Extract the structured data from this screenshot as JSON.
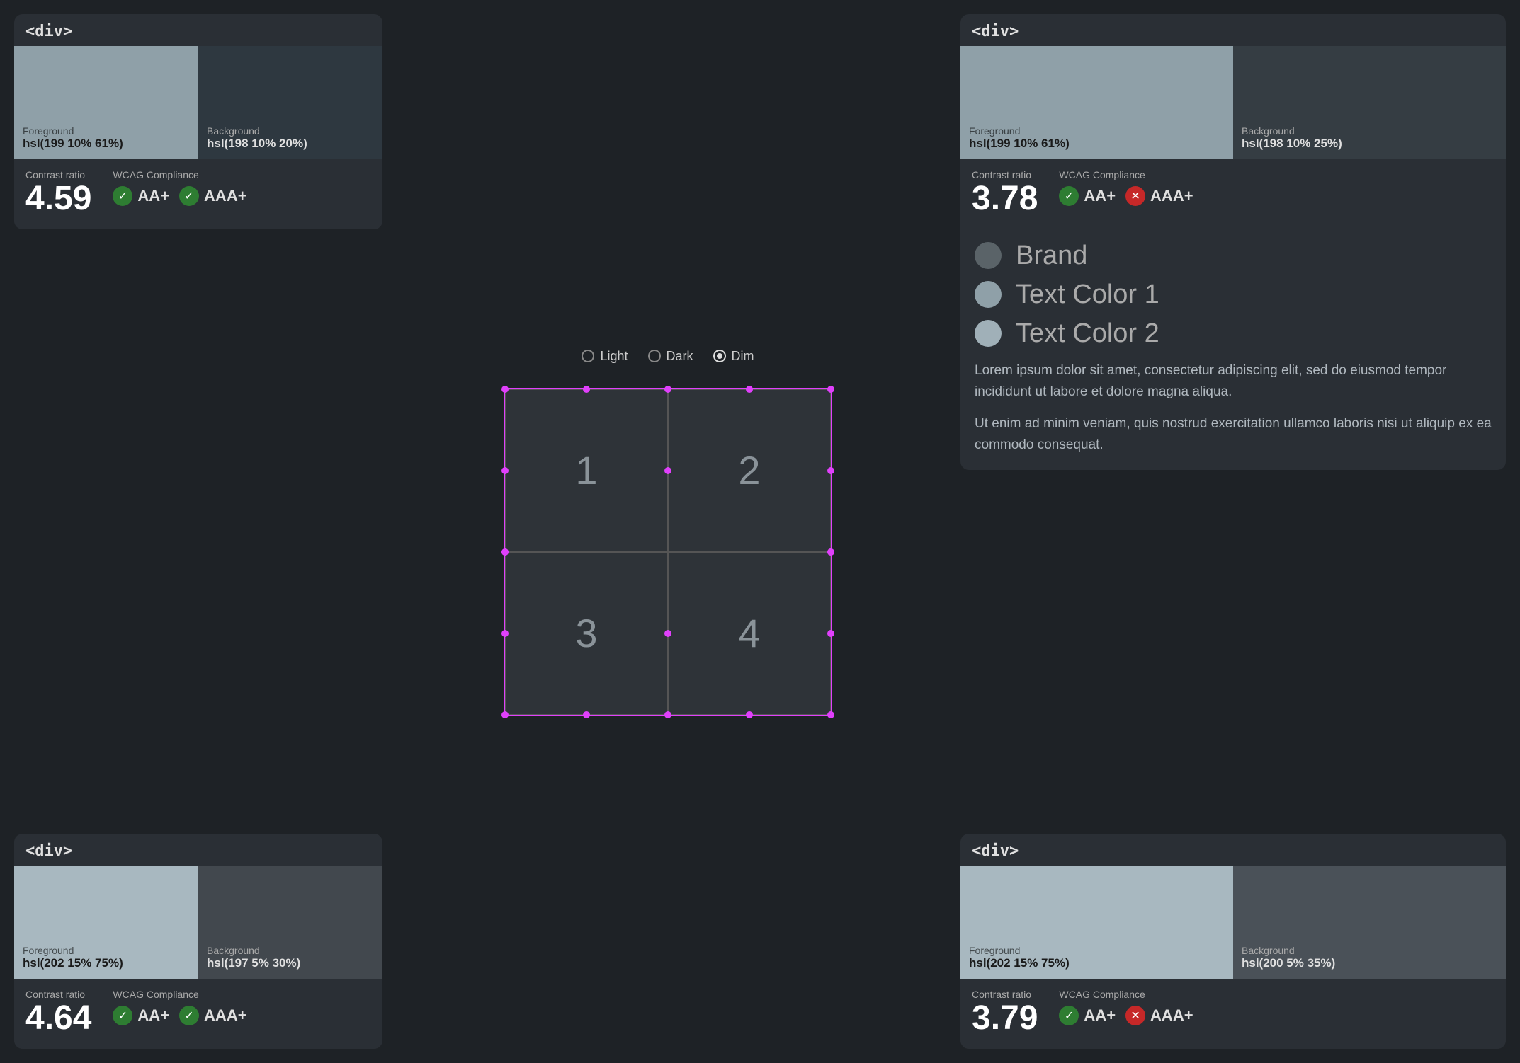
{
  "panels": {
    "topLeft": {
      "tag": "<div>",
      "foreground": {
        "label": "Foreground",
        "value": "hsl(199 10% 61%)"
      },
      "background": {
        "label": "Background",
        "value": "hsl(198 10% 20%)"
      },
      "contrastLabel": "Contrast ratio",
      "contrastValue": "4.59",
      "wcagLabel": "WCAG Compliance",
      "badges": [
        {
          "icon": "check",
          "type": "green",
          "label": "AA+"
        },
        {
          "icon": "check",
          "type": "green",
          "label": "AAA+"
        }
      ],
      "swatchFgBg": "#8fa0a8",
      "swatchBg": "#2e3840"
    },
    "topRight": {
      "tag": "<div>",
      "foreground": {
        "label": "Foreground",
        "value": "hsl(199 10% 61%)"
      },
      "background": {
        "label": "Background",
        "value": "hsl(198 10% 25%)"
      },
      "contrastLabel": "Contrast ratio",
      "contrastValue": "3.78",
      "wcagLabel": "WCAG Compliance",
      "badges": [
        {
          "icon": "check",
          "type": "green",
          "label": "AA+"
        },
        {
          "icon": "x",
          "type": "red",
          "label": "AAA+"
        }
      ],
      "swatchFgBg": "#8fa0a8",
      "swatchBg": "#353d43"
    },
    "bottomLeft": {
      "tag": "<div>",
      "foreground": {
        "label": "Foreground",
        "value": "hsl(202 15% 75%)"
      },
      "background": {
        "label": "Background",
        "value": "hsl(197 5% 30%)"
      },
      "contrastLabel": "Contrast ratio",
      "contrastValue": "4.64",
      "wcagLabel": "WCAG Compliance",
      "badges": [
        {
          "icon": "check",
          "type": "green",
          "label": "AA+"
        },
        {
          "icon": "check",
          "type": "green",
          "label": "AAA+"
        }
      ],
      "swatchFgBg": "#a8b8c0",
      "swatchBg": "#42484e"
    },
    "bottomRight": {
      "tag": "<div>",
      "foreground": {
        "label": "Foreground",
        "value": "hsl(202 15% 75%)"
      },
      "background": {
        "label": "Background",
        "value": "hsl(200 5% 35%)"
      },
      "contrastLabel": "Contrast ratio",
      "contrastValue": "3.79",
      "wcagLabel": "WCAG Compliance",
      "badges": [
        {
          "icon": "check",
          "type": "green",
          "label": "AA+"
        },
        {
          "icon": "x",
          "type": "red",
          "label": "AAA+"
        }
      ],
      "swatchFgBg": "#a8b8c0",
      "swatchBg": "#4a5158"
    }
  },
  "center": {
    "themeOptions": [
      "Light",
      "Dark",
      "Dim"
    ],
    "selectedTheme": "Dim",
    "boxes": [
      "1",
      "2",
      "3",
      "4"
    ]
  },
  "rightLegend": {
    "items": [
      {
        "label": "Brand",
        "color": "#5a6368"
      },
      {
        "label": "Text Color 1",
        "color": "#8fa0a8"
      },
      {
        "label": "Text Color 2",
        "color": "#a0b0b8"
      }
    ],
    "paragraphs": [
      "Lorem ipsum dolor sit amet, consectetur adipiscing elit, sed do eiusmod tempor incididunt ut labore et dolore magna aliqua.",
      "Ut enim ad minim veniam, quis nostrud exercitation ullamco laboris nisi ut aliquip ex ea commodo consequat."
    ]
  }
}
